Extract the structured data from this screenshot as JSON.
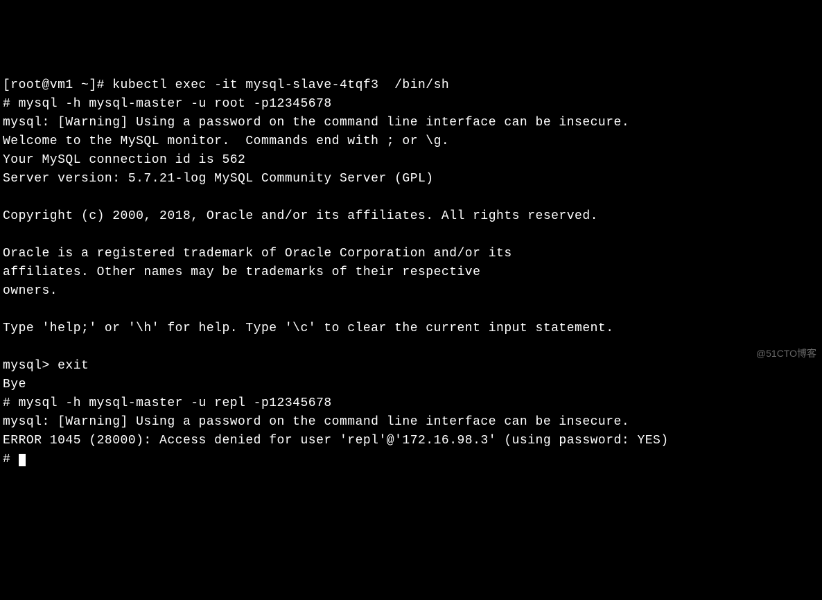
{
  "terminal": {
    "lines": {
      "l0": "[root@vm1 ~]# kubectl exec -it mysql-slave-4tqf3  /bin/sh",
      "l1": "# mysql -h mysql-master -u root -p12345678",
      "l2": "mysql: [Warning] Using a password on the command line interface can be insecure.",
      "l3": "Welcome to the MySQL monitor.  Commands end with ; or \\g.",
      "l4": "Your MySQL connection id is 562",
      "l5": "Server version: 5.7.21-log MySQL Community Server (GPL)",
      "l6": "",
      "l7": "Copyright (c) 2000, 2018, Oracle and/or its affiliates. All rights reserved.",
      "l8": "",
      "l9": "Oracle is a registered trademark of Oracle Corporation and/or its",
      "l10": "affiliates. Other names may be trademarks of their respective",
      "l11": "owners.",
      "l12": "",
      "l13": "Type 'help;' or '\\h' for help. Type '\\c' to clear the current input statement.",
      "l14": "",
      "l15": "mysql> exit",
      "l16": "Bye",
      "l17": "# mysql -h mysql-master -u repl -p12345678",
      "l18": "mysql: [Warning] Using a password on the command line interface can be insecure.",
      "l19": "ERROR 1045 (28000): Access denied for user 'repl'@'172.16.98.3' (using password: YES)",
      "l20": "# "
    }
  },
  "watermark": "@51CTO博客"
}
